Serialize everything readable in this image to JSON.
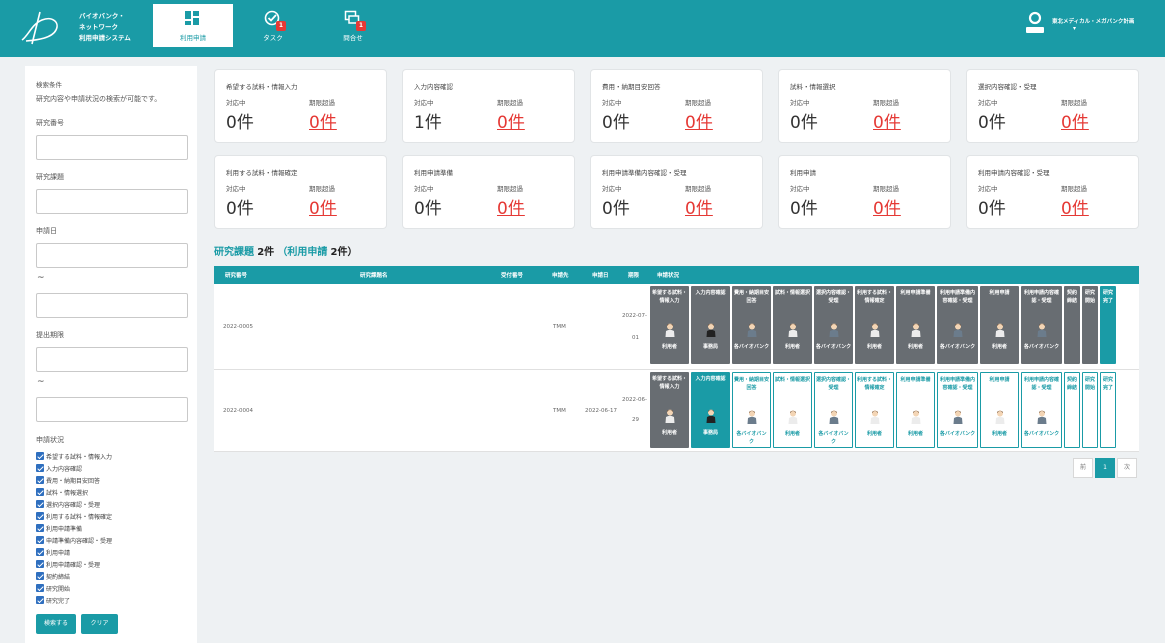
{
  "header": {
    "brand_lines": [
      "バイオバンク・",
      "ネットワーク",
      "利用申請システム"
    ],
    "nav": [
      {
        "label": "利用申請",
        "icon": "dashboard-icon",
        "active": true,
        "badge": ""
      },
      {
        "label": "タスク",
        "icon": "task-check-icon",
        "active": false,
        "badge": "1"
      },
      {
        "label": "問合せ",
        "icon": "inquiry-icon",
        "active": false,
        "badge": "1"
      }
    ],
    "user_name": "東北メディカル・メガバンク計画",
    "user_caret": "▾",
    "colors": {
      "primary": "#1a9ba6",
      "badge": "#e53935"
    }
  },
  "sidebar": {
    "title": "検索条件",
    "description": "研究内容や申請状況の検索が可能です。",
    "research_number_label": "研究番号",
    "research_number_value": "",
    "research_title_label": "研究課題",
    "research_title_value": "",
    "apply_date_label": "申請日",
    "apply_date_from": "",
    "apply_date_to": "",
    "deadline_label": "提出期限",
    "deadline_from": "",
    "deadline_to": "",
    "tilde": "~",
    "status_label": "申請状況",
    "status_options": [
      "希望する試料・情報入力",
      "入力内容確認",
      "費用・納期目安回答",
      "試料・情報選択",
      "選択内容確認・受理",
      "利用する試料・情報確定",
      "利用申請準備",
      "申請準備内容確認・受理",
      "利用申請",
      "利用申請確認・受理",
      "契約締結",
      "研究開始",
      "研究完了"
    ],
    "search_button": "検索する",
    "clear_button": "クリア"
  },
  "summary_cards": [
    {
      "title": "希望する試料・情報入力",
      "in_progress_label": "対応中",
      "overdue_label": "期限超過",
      "in_progress": "0件",
      "overdue": "0件"
    },
    {
      "title": "入力内容確認",
      "in_progress_label": "対応中",
      "overdue_label": "期限超過",
      "in_progress": "1件",
      "overdue": "0件"
    },
    {
      "title": "費用・納期目安回答",
      "in_progress_label": "対応中",
      "overdue_label": "期限超過",
      "in_progress": "0件",
      "overdue": "0件"
    },
    {
      "title": "試料・情報選択",
      "in_progress_label": "対応中",
      "overdue_label": "期限超過",
      "in_progress": "0件",
      "overdue": "0件"
    },
    {
      "title": "選択内容確認・受理",
      "in_progress_label": "対応中",
      "overdue_label": "期限超過",
      "in_progress": "0件",
      "overdue": "0件"
    },
    {
      "title": "利用する試料・情報確定",
      "in_progress_label": "対応中",
      "overdue_label": "期限超過",
      "in_progress": "0件",
      "overdue": "0件"
    },
    {
      "title": "利用申請準備",
      "in_progress_label": "対応中",
      "overdue_label": "期限超過",
      "in_progress": "0件",
      "overdue": "0件"
    },
    {
      "title": "利用申請準備内容確認・受理",
      "in_progress_label": "対応中",
      "overdue_label": "期限超過",
      "in_progress": "0件",
      "overdue": "0件"
    },
    {
      "title": "利用申請",
      "in_progress_label": "対応中",
      "overdue_label": "期限超過",
      "in_progress": "0件",
      "overdue": "0件"
    },
    {
      "title": "利用申請内容確認・受理",
      "in_progress_label": "対応中",
      "overdue_label": "期限超過",
      "in_progress": "0件",
      "overdue": "0件"
    }
  ],
  "results": {
    "heading_part1": "研究課題",
    "heading_part2": "2件",
    "heading_part3": "（利用申請",
    "heading_part4": "2件）",
    "columns": [
      "研究番号",
      "研究課題名",
      "受付番号",
      "申請先",
      "申請日",
      "期限",
      "申請状況"
    ],
    "rows": [
      {
        "research_number": "2022-0005",
        "research_title": "",
        "receipt_number": "",
        "apply_to": "TMM",
        "apply_date": "",
        "deadline_line1": "2022-07-",
        "deadline_line2": "01",
        "statuses": [
          {
            "label": "希望する試料・情報入力",
            "who": "利用者",
            "state": "done",
            "icon": "user-person-icon"
          },
          {
            "label": "入力内容確認",
            "who": "事務局",
            "state": "done",
            "icon": "staff-person-icon"
          },
          {
            "label": "費用・納期目安回答",
            "who": "各バイオバンク",
            "state": "done",
            "icon": "biobank-person-icon"
          },
          {
            "label": "試料・情報選択",
            "who": "利用者",
            "state": "done",
            "icon": "user-person-icon"
          },
          {
            "label": "選択内容確認・受理",
            "who": "各バイオバンク",
            "state": "done",
            "icon": "biobank-person-icon"
          },
          {
            "label": "利用する試料・情報確定",
            "who": "利用者",
            "state": "done",
            "icon": "user-person-icon"
          },
          {
            "label": "利用申請準備",
            "who": "利用者",
            "state": "done",
            "icon": "user-person-icon"
          },
          {
            "label": "利用申請準備内容確認・受理",
            "who": "各バイオバンク",
            "state": "done",
            "icon": "biobank-person-icon"
          },
          {
            "label": "利用申請",
            "who": "利用者",
            "state": "done",
            "icon": "user-person-icon"
          },
          {
            "label": "利用申請内容確認・受理",
            "who": "各バイオバンク",
            "state": "done",
            "icon": "biobank-person-icon"
          },
          {
            "label": "契約締結",
            "who": "",
            "state": "done",
            "icon": ""
          },
          {
            "label": "研究開始",
            "who": "",
            "state": "done",
            "icon": ""
          },
          {
            "label": "研究完了",
            "who": "",
            "state": "current",
            "icon": ""
          }
        ]
      },
      {
        "research_number": "2022-0004",
        "research_title": "",
        "receipt_number": "",
        "apply_to": "TMM",
        "apply_date": "2022-06-17",
        "deadline_line1": "2022-06-",
        "deadline_line2": "29",
        "statuses": [
          {
            "label": "希望する試料・情報入力",
            "who": "利用者",
            "state": "done",
            "icon": "user-person-icon"
          },
          {
            "label": "入力内容確認",
            "who": "事務局",
            "state": "current",
            "icon": "staff-person-icon"
          },
          {
            "label": "費用・納期目安回答",
            "who": "各バイオバンク",
            "state": "todo",
            "icon": "biobank-person-icon"
          },
          {
            "label": "試料・情報選択",
            "who": "利用者",
            "state": "todo",
            "icon": "user-person-icon"
          },
          {
            "label": "選択内容確認・受理",
            "who": "各バイオバンク",
            "state": "todo",
            "icon": "biobank-person-icon"
          },
          {
            "label": "利用する試料・情報確定",
            "who": "利用者",
            "state": "todo",
            "icon": "user-person-icon"
          },
          {
            "label": "利用申請準備",
            "who": "利用者",
            "state": "todo",
            "icon": "user-person-icon"
          },
          {
            "label": "利用申請準備内容確認・受理",
            "who": "各バイオバンク",
            "state": "todo",
            "icon": "biobank-person-icon"
          },
          {
            "label": "利用申請",
            "who": "利用者",
            "state": "todo",
            "icon": "user-person-icon"
          },
          {
            "label": "利用申請内容確認・受理",
            "who": "各バイオバンク",
            "state": "todo",
            "icon": "biobank-person-icon"
          },
          {
            "label": "契約締結",
            "who": "",
            "state": "todo",
            "icon": ""
          },
          {
            "label": "研究開始",
            "who": "",
            "state": "todo",
            "icon": ""
          },
          {
            "label": "研究完了",
            "who": "",
            "state": "todo",
            "icon": ""
          }
        ]
      }
    ]
  },
  "pagination": {
    "prev": "前",
    "current": "1",
    "next": "次"
  }
}
